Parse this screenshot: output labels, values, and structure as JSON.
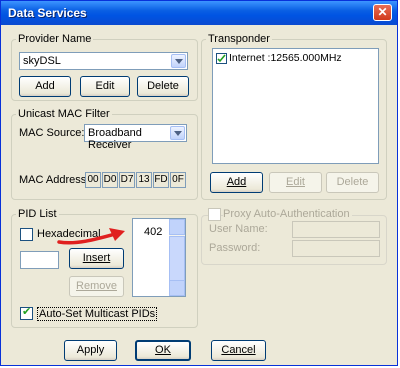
{
  "window": {
    "title": "Data Services",
    "close_symbol": "✕"
  },
  "provider": {
    "legend": "Provider Name",
    "selected": "skyDSL",
    "add": "Add",
    "edit": "Edit",
    "delete": "Delete"
  },
  "mac_filter": {
    "legend": "Unicast MAC Filter",
    "source_label": "MAC Source:",
    "source_value": "Broadband Receiver",
    "address_label": "MAC Address:",
    "address": [
      "00",
      "D0",
      "D7",
      "13",
      "FD",
      "0F"
    ]
  },
  "pid": {
    "legend": "PID List",
    "hexadecimal_label": "Hexadecimal",
    "hexadecimal_checked": false,
    "input_value": "",
    "insert": "Insert",
    "remove": "Remove",
    "list": [
      "402"
    ],
    "auto_set_label": "Auto-Set Multicast PIDs",
    "auto_set_checked": true
  },
  "transponder": {
    "legend": "Transponder",
    "items": [
      {
        "label": "Internet :12565.000MHz",
        "checked": true
      }
    ],
    "add": "Add",
    "edit": "Edit",
    "delete": "Delete"
  },
  "proxy": {
    "label": "Proxy Auto-Authentication",
    "checked": false,
    "user_label": "User Name:",
    "password_label": "Password:"
  },
  "footer": {
    "apply": "Apply",
    "ok": "OK",
    "cancel": "Cancel"
  },
  "colors": {
    "titlebar": "#0054e3",
    "dialog_bg": "#ece9d8",
    "annotation_arrow": "#e0201f"
  }
}
